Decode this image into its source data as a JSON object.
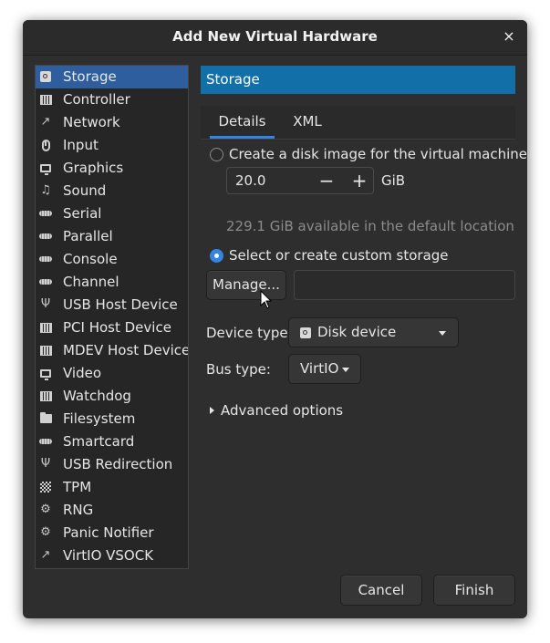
{
  "window": {
    "title": "Add New Virtual Hardware",
    "close_glyph": "×"
  },
  "sidebar": {
    "items": [
      {
        "label": "Storage",
        "icon": "disk-icon",
        "selected": true
      },
      {
        "label": "Controller",
        "icon": "controller-chip-icon"
      },
      {
        "label": "Network",
        "icon": "network-icon"
      },
      {
        "label": "Input",
        "icon": "mouse-icon"
      },
      {
        "label": "Graphics",
        "icon": "monitor-icon"
      },
      {
        "label": "Sound",
        "icon": "sound-icon"
      },
      {
        "label": "Serial",
        "icon": "serial-port-icon"
      },
      {
        "label": "Parallel",
        "icon": "parallel-port-icon"
      },
      {
        "label": "Console",
        "icon": "console-port-icon"
      },
      {
        "label": "Channel",
        "icon": "channel-port-icon"
      },
      {
        "label": "USB Host Device",
        "icon": "usb-icon"
      },
      {
        "label": "PCI Host Device",
        "icon": "pci-chip-icon"
      },
      {
        "label": "MDEV Host Device",
        "icon": "mdev-chip-icon"
      },
      {
        "label": "Video",
        "icon": "video-monitor-icon"
      },
      {
        "label": "Watchdog",
        "icon": "watchdog-chip-icon"
      },
      {
        "label": "Filesystem",
        "icon": "folder-icon"
      },
      {
        "label": "Smartcard",
        "icon": "smartcard-icon"
      },
      {
        "label": "USB Redirection",
        "icon": "usb-redirection-icon"
      },
      {
        "label": "TPM",
        "icon": "tpm-chip-icon"
      },
      {
        "label": "RNG",
        "icon": "rng-gear-icon"
      },
      {
        "label": "Panic Notifier",
        "icon": "panic-gear-icon"
      },
      {
        "label": "VirtIO VSOCK",
        "icon": "vsock-network-icon"
      }
    ]
  },
  "main": {
    "header": "Storage",
    "tabs": [
      {
        "label": "Details",
        "active": true
      },
      {
        "label": "XML",
        "active": false
      }
    ],
    "create_disk": {
      "label": "Create a disk image for the virtual machine",
      "checked": false,
      "size_value": "20.0",
      "decrement_glyph": "−",
      "increment_glyph": "+",
      "unit": "GiB",
      "available_hint": "229.1 GiB available in the default location"
    },
    "custom_storage": {
      "label": "Select or create custom storage",
      "checked": true,
      "manage_label": "Manage...",
      "path_value": ""
    },
    "device_type": {
      "label": "Device type:",
      "value": "Disk device",
      "icon": "disk-icon"
    },
    "bus_type": {
      "label": "Bus type:",
      "value": "VirtIO"
    },
    "advanced": {
      "label": "Advanced options",
      "expanded": false
    }
  },
  "footer": {
    "cancel_label": "Cancel",
    "finish_label": "Finish"
  },
  "colors": {
    "window_bg": "#2e2e2e",
    "header_bg": "#126fa8",
    "selection_bg": "#2e5e9e",
    "accent": "#3584e4",
    "hint_text": "#8c8c8c"
  }
}
